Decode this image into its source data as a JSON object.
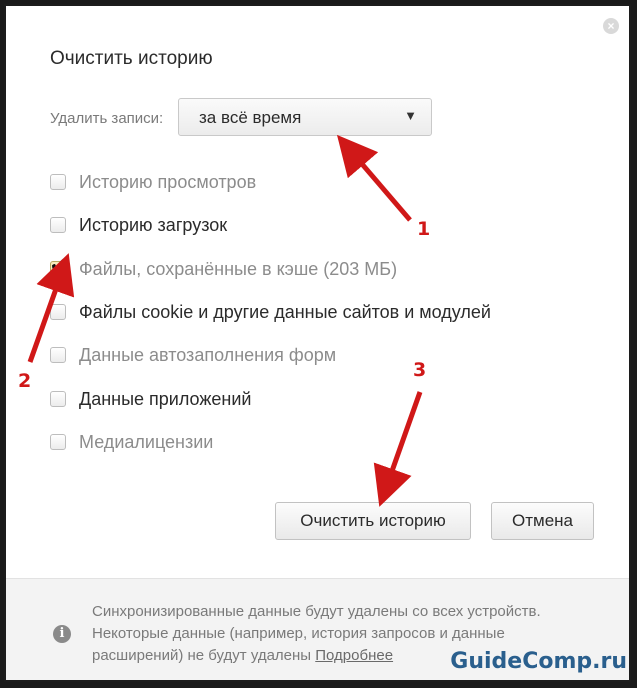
{
  "dialog": {
    "title": "Очистить историю",
    "close_glyph": "×",
    "period": {
      "label": "Удалить записи:",
      "selected": "за всё время",
      "chevron_icon": "chevron-down-icon"
    },
    "options": [
      {
        "label": "Историю просмотров",
        "checked": false
      },
      {
        "label": "Историю загрузок",
        "checked": false
      },
      {
        "label": "Файлы, сохранённые в кэше (203 МБ)",
        "checked": true
      },
      {
        "label": "Файлы cookie и другие данные сайтов и модулей",
        "checked": false
      },
      {
        "label": "Данные автозаполнения форм",
        "checked": false
      },
      {
        "label": "Данные приложений",
        "checked": false
      },
      {
        "label": "Медиалицензии",
        "checked": false
      }
    ],
    "buttons": {
      "clear": "Очистить историю",
      "cancel": "Отмена"
    },
    "footer": {
      "info_icon": "info-icon",
      "note_line1": "Синхронизированные данные будут удалены со всех устройств.",
      "note_line2": "Некоторые данные (например, история запросов и данные",
      "note_line3": "расширений) не будут удалены ",
      "link": "Подробнее"
    }
  },
  "annotations": {
    "marker1": "1",
    "marker2": "2",
    "marker3": "3",
    "color": "#d01818"
  },
  "watermark": "GuideComp.ru"
}
